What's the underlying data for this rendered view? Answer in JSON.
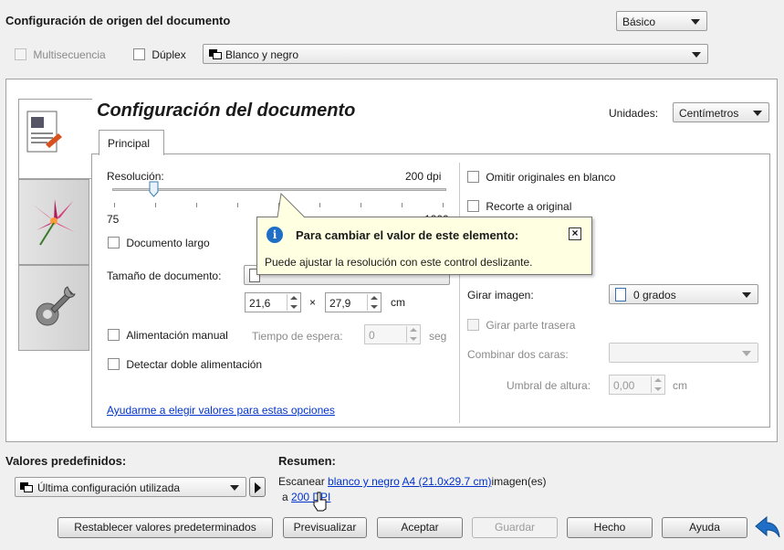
{
  "header": {
    "title": "Configuración de origen del documento",
    "mode_select": "Básico",
    "multisequence_label": "Multisecuencia",
    "duplex_label": "Dúplex",
    "color_select": "Blanco y negro"
  },
  "doc": {
    "title": "Configuración del documento",
    "units_label": "Unidades:",
    "units_value": "Centímetros",
    "tab_main": "Principal"
  },
  "left": {
    "resolution_label": "Resolución:",
    "resolution_value": "200 dpi",
    "slider_min": "75",
    "slider_max_partial": "1200",
    "slider_position": 0.12,
    "long_doc_label": "Documento largo",
    "size_label": "Tamaño de documento:",
    "width_value": "21,6",
    "times_sign": "×",
    "height_value": "27,9",
    "size_unit": "cm",
    "manual_feed_label": "Alimentación manual",
    "wait_label": "Tiempo de espera:",
    "wait_value": "0",
    "wait_unit": "seg",
    "double_feed_label": "Detectar doble alimentación",
    "help_link": "Ayudarme a elegir valores para estas opciones"
  },
  "right": {
    "skip_blank_label": "Omitir originales en blanco",
    "crop_label": "Recorte a original",
    "rotate_label": "Girar imagen:",
    "rotate_value": "0 grados",
    "rotate_back_label": "Girar parte trasera",
    "combine_label": "Combinar dos caras:",
    "combine_value": "",
    "height_threshold_label": "Umbral de altura:",
    "height_threshold_value": "0,00",
    "height_threshold_unit": "cm"
  },
  "tooltip": {
    "title": "Para cambiar el valor de este elemento:",
    "body": "Puede ajustar la resolución con este control deslizante."
  },
  "presets": {
    "label": "Valores predefinidos:",
    "value": "Última configuración utilizada"
  },
  "summary": {
    "label": "Resumen:",
    "prefix": "Escanear",
    "color_link": "blanco y negro",
    "size_link": "A4 (21.0x29.7 cm)",
    "mid": "imagen(es)",
    "at": "a",
    "dpi_link": "200 DPI"
  },
  "buttons": {
    "reset": "Restablecer valores predeterminados",
    "preview": "Previsualizar",
    "accept": "Aceptar",
    "save": "Guardar",
    "done": "Hecho",
    "help": "Ayuda"
  },
  "colors": {
    "accent": "#1f6fc7",
    "link": "#0033cc",
    "tooltip_bg": "#ffffe1"
  }
}
